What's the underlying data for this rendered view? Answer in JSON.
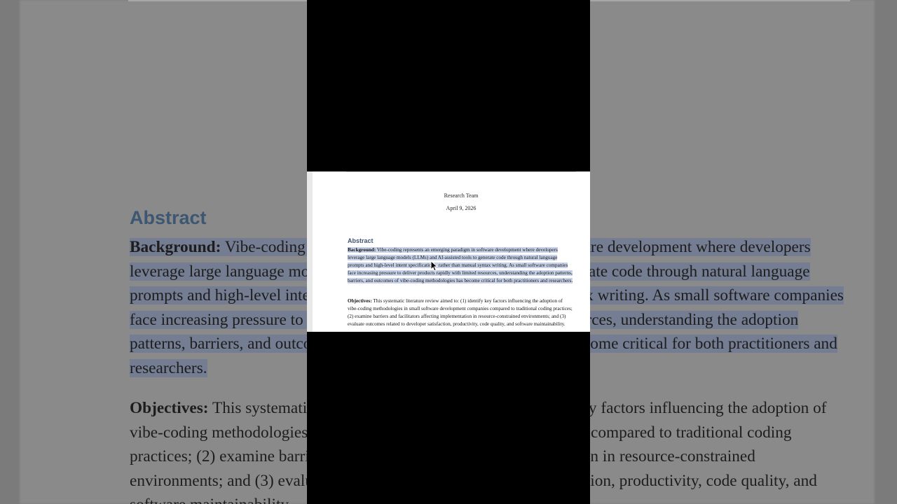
{
  "document": {
    "author": "Research Team",
    "date": "April 9, 2026",
    "section_heading": "Abstract",
    "background_label": "Background:",
    "background_text": " Vibe-coding represents an emerging paradigm in software development where developers leverage large language models (LLMs) and AI-assisted tools to generate code through natural language prompts and high-level intent specifications, rather than manual syntax writing. As small software companies face increasing pressure to deliver products rapidly with limited resources, understanding the adoption patterns, barriers, and outcomes of vibe-coding methodologies has become critical for both practitioners and researchers.",
    "objectives_label": "Objectives:",
    "objectives_text": " This systematic literature review aimed to: (1) identify key factors influencing the adoption of vibe-coding methodologies in small software development companies compared to traditional coding practices; (2) examine barriers and facilitators affecting implementation in resource-constrained environments; and (3) evaluate outcomes related to developer satisfaction, productivity, code quality, and software maintainability."
  },
  "colors": {
    "heading": "#3d5672",
    "selection": "#c8d3ea",
    "frame_background": "#000000"
  },
  "icons": {
    "cursor": "mouse-pointer-icon"
  }
}
